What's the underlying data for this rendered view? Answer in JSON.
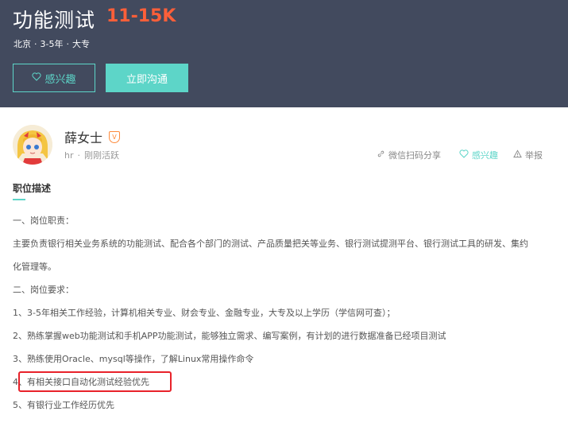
{
  "job": {
    "title": "功能测试",
    "salary": "11-15K",
    "city": "北京",
    "experience": "3-5年",
    "education": "大专",
    "separator": "·"
  },
  "buttons": {
    "interest": "感兴趣",
    "chat": "立即沟通"
  },
  "recruiter": {
    "name": "薛女士",
    "verified_badge": "V",
    "role": "hr",
    "status": "刚刚活跃"
  },
  "actions": {
    "share": "微信扫码分享",
    "interest": "感兴趣",
    "report": "举报"
  },
  "section": {
    "title": "职位描述"
  },
  "description": {
    "lines": [
      "一、岗位职责：",
      "主要负责银行相关业务系统的功能测试、配合各个部门的测试、产品质量把关等业务、银行测试提测平台、银行测试工具的研发、集约",
      "化管理等。",
      "二、岗位要求：",
      "1、3-5年相关工作经验，计算机相关专业、财会专业、金融专业，大专及以上学历（学信网可查）；",
      "2、熟练掌握web功能测试和手机APP功能测试，能够独立需求、编写案例，有计划的进行数据准备已经项目测试",
      "3、熟练使用Oracle、mysql等操作，了解Linux常用操作命令",
      "4、有相关接口自动化测试经验优先",
      "5、有银行业工作经历优先"
    ]
  },
  "colors": {
    "header_bg": "#424a5e",
    "accent": "#5dd5c8",
    "salary": "#fd5f39",
    "highlight": "#e8222a"
  }
}
